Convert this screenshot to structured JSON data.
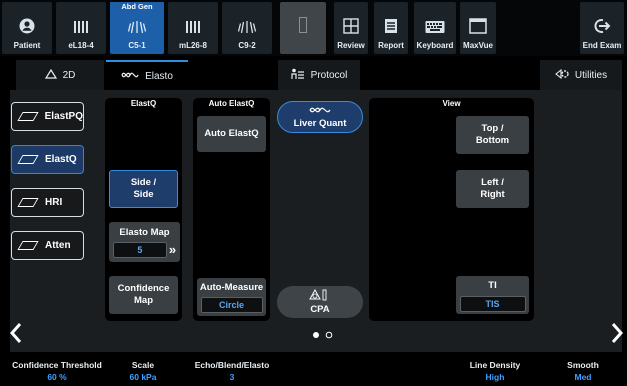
{
  "toolbar": {
    "patient": {
      "label": "Patient",
      "icon": "user-circle-icon"
    },
    "probes": [
      {
        "label": "eL18-4",
        "icon": "linear-probe-icon",
        "active": false,
        "preset": ""
      },
      {
        "label": "C5-1",
        "icon": "curved-probe-icon",
        "active": true,
        "preset": "Abd Gen"
      },
      {
        "label": "mL26-8",
        "icon": "linear-probe-icon",
        "active": false,
        "preset": ""
      },
      {
        "label": "C9-2",
        "icon": "curved-probe-icon",
        "active": false,
        "preset": ""
      }
    ],
    "blank_icon": "placeholder-icon",
    "review": {
      "label": "Review",
      "icon": "grid-icon"
    },
    "report": {
      "label": "Report",
      "icon": "report-icon"
    },
    "keyboard": {
      "label": "Keyboard",
      "icon": "keyboard-icon"
    },
    "maxvue": {
      "label": "MaxVue",
      "icon": "window-icon"
    },
    "end_exam": {
      "label": "End Exam",
      "icon": "exit-icon"
    }
  },
  "tabs": {
    "t2d": {
      "label": "2D",
      "icon": "triangle-icon"
    },
    "elasto": {
      "label": "Elasto",
      "icon": "elasto-icon",
      "active": true
    },
    "protocol": {
      "label": "Protocol",
      "icon": "protocol-icon"
    },
    "utilities": {
      "label": "Utilities",
      "icon": "utilities-icon"
    }
  },
  "modes": [
    {
      "label": "ElastPQ",
      "active": false
    },
    {
      "label": "ElastQ",
      "active": true
    },
    {
      "label": "HRI",
      "active": false
    },
    {
      "label": "Atten",
      "active": false
    }
  ],
  "elastq": {
    "header": "ElastQ",
    "side_side_line1": "Side /",
    "side_side_line2": "Side",
    "elasto_map_label": "Elasto Map",
    "elasto_map_value": "5",
    "confidence_map": "Confidence Map"
  },
  "auto_elastq": {
    "header": "Auto ElastQ",
    "button": "Auto ElastQ",
    "auto_measure_label": "Auto-Measure",
    "auto_measure_value": "Circle"
  },
  "presets": {
    "liver_quant": "Liver Quant",
    "cpa": "CPA"
  },
  "view": {
    "header": "View",
    "top_bottom_line1": "Top /",
    "top_bottom_line2": "Bottom",
    "left_right_line1": "Left /",
    "left_right_line2": "Right",
    "ti_label": "TI",
    "ti_value": "TIS"
  },
  "pagination": {
    "current": 1,
    "total": 2
  },
  "status": {
    "confidence_threshold": {
      "label": "Confidence Threshold",
      "value": "60 %"
    },
    "scale": {
      "label": "Scale",
      "value": "60 kPa"
    },
    "echo_blend": {
      "label": "Echo/Blend/Elasto",
      "value": "3"
    },
    "line_density": {
      "label": "Line Density",
      "value": "High"
    },
    "smooth": {
      "label": "Smooth",
      "value": "Med"
    }
  },
  "colors": {
    "accent": "#1d5fa8",
    "value_blue": "#3fa0ff",
    "panel": "#1a1e21"
  }
}
